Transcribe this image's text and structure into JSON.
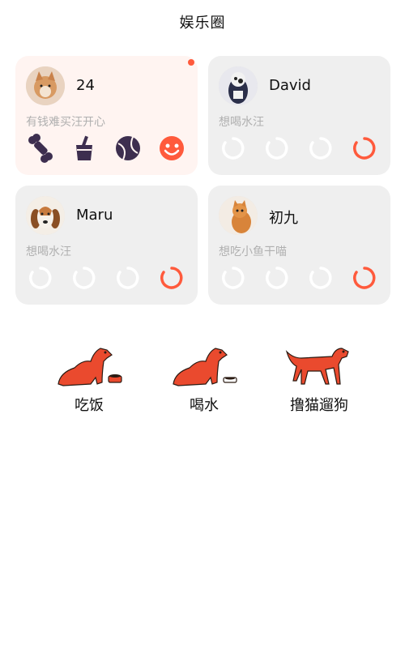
{
  "header": {
    "title": "娱乐圈"
  },
  "cards": [
    {
      "name": "24",
      "status": "有钱难买汪开心",
      "active": true
    },
    {
      "name": "David",
      "status": "想喝水汪"
    },
    {
      "name": "Maru",
      "status": "想喝水汪"
    },
    {
      "name": "初九",
      "status": "想吃小鱼干喵"
    }
  ],
  "card_icons": {
    "active_icons": [
      "bone-icon",
      "cup-icon",
      "ball-icon",
      "smiley-icon"
    ],
    "inactive_icons": [
      "loading-ring-icon",
      "loading-ring-icon",
      "loading-ring-icon",
      "loading-ring-accent-icon"
    ]
  },
  "actions": [
    {
      "label": "吃饭"
    },
    {
      "label": "喝水"
    },
    {
      "label": "撸猫遛狗"
    }
  ],
  "colors": {
    "accent": "#ff5a3c",
    "dark_icon": "#3d2e4f",
    "card_bg": "#efefef",
    "card_active_bg": "#fff4f1",
    "muted_text": "#b0b0b0"
  }
}
